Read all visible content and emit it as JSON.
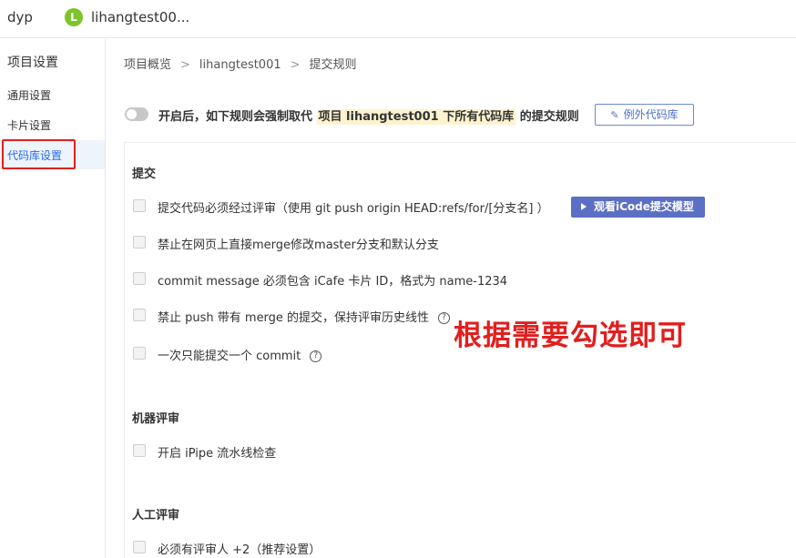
{
  "topbar": {
    "org_name": "dyp",
    "project_initial": "L",
    "project_name": "lihangtest00..."
  },
  "sidebar": {
    "title": "项目设置",
    "items": [
      {
        "label": "通用设置",
        "active": false
      },
      {
        "label": "卡片设置",
        "active": false
      },
      {
        "label": "代码库设置",
        "active": true
      }
    ]
  },
  "breadcrumb": [
    "项目概览",
    "lihangtest001",
    "提交规则"
  ],
  "breadcrumb_sep": ">",
  "toggle_row": {
    "enabled": false,
    "text_before": "开启后，如下规则会强制取代 ",
    "text_highlight": "项目 lihangtest001 下所有代码库",
    "text_after": " 的提交规则",
    "exception_button": "例外代码库"
  },
  "sections": {
    "commit": {
      "title": "提交",
      "rules": [
        {
          "label": "提交代码必须经过评审（使用 git push origin HEAD:refs/for/[分支名] ）",
          "checked": false
        },
        {
          "label": "禁止在网页上直接merge修改master分支和默认分支",
          "checked": false
        },
        {
          "label": "commit message 必须包含 iCafe 卡片 ID，格式为 name-1234",
          "checked": false
        },
        {
          "label": "禁止 push 带有 merge 的提交，保持评审历史线性",
          "checked": false
        },
        {
          "label": "一次只能提交一个 commit",
          "checked": false
        }
      ],
      "watch_button": "观看iCode提交模型"
    },
    "machine_review": {
      "title": "机器评审",
      "rules": [
        {
          "label": "开启 iPipe 流水线检查",
          "checked": false
        }
      ]
    },
    "manual_review": {
      "title": "人工评审",
      "rules": [
        {
          "label": "必须有评审人 +2（推荐设置）",
          "checked": false
        }
      ]
    }
  },
  "help_glyph": "?",
  "annotation_text": "根据需要勾选即可",
  "colors": {
    "accent_blue": "#2468f2",
    "button_purple": "#5b6fc4",
    "annotation_red": "#e21e1e",
    "avatar_green": "#7cc42b",
    "highlight_yellow": "#fdf3cf"
  },
  "icons": {
    "edit": "pencil-icon",
    "play": "play-icon",
    "help": "question-circle-icon"
  }
}
